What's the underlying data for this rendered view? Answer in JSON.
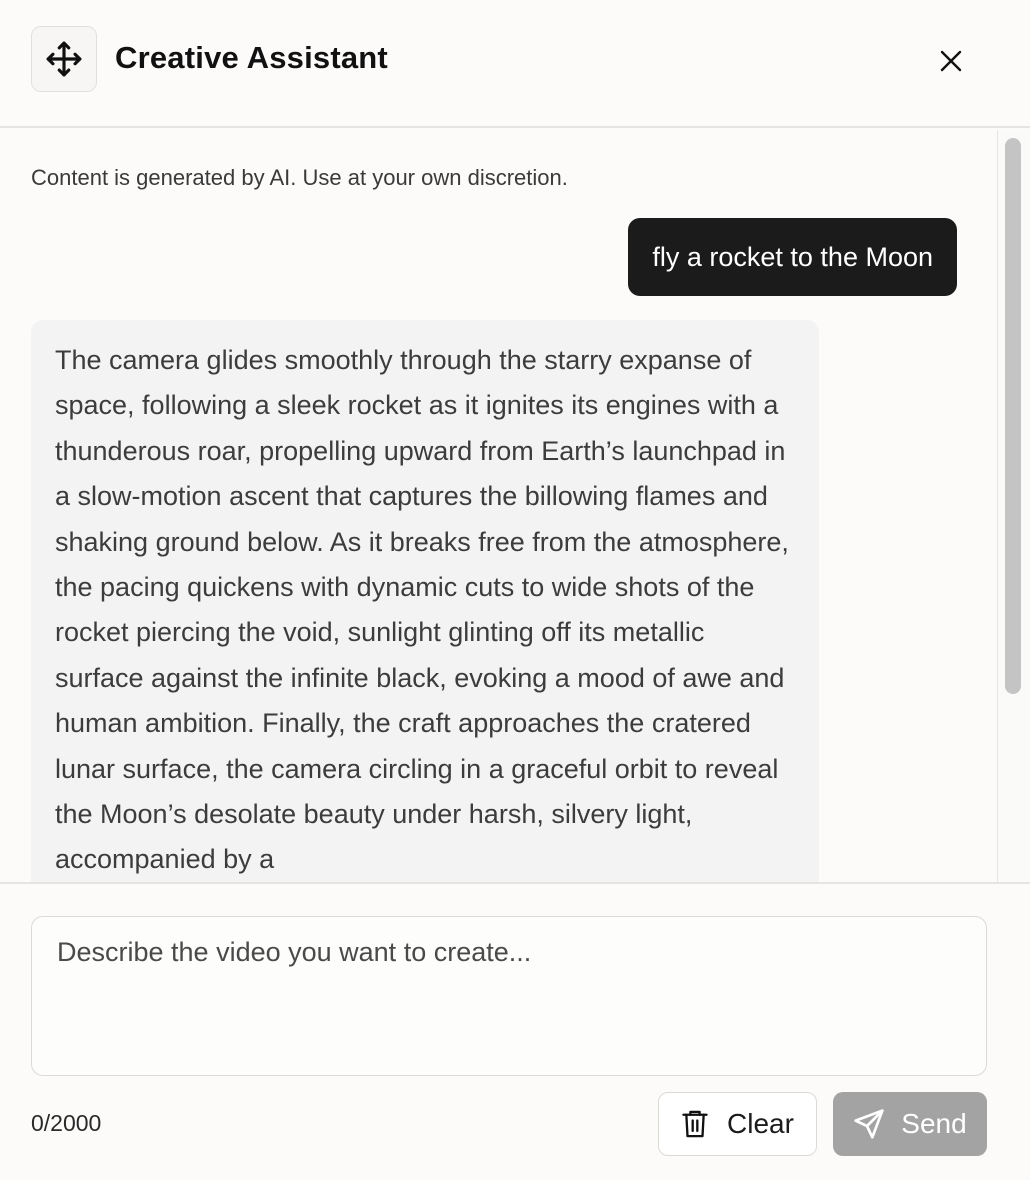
{
  "header": {
    "title": "Creative Assistant",
    "drag_icon": "move-icon",
    "close_icon": "close-icon"
  },
  "chat": {
    "disclaimer": "Content is generated by AI. Use at your own discretion.",
    "messages": [
      {
        "role": "user",
        "text": "fly a rocket to the Moon"
      },
      {
        "role": "assistant",
        "text": "The camera glides smoothly through the starry expanse of space, following a sleek rocket as it ignites its engines with a thunderous roar, propelling upward from Earth’s launchpad in a slow-motion ascent that captures the billowing flames and shaking ground below. As it breaks free from the atmosphere, the pacing quickens with dynamic cuts to wide shots of the rocket piercing the void, sunlight glinting off its metallic surface against the infinite black, evoking a mood of awe and human ambition. Finally, the craft approaches the cratered lunar surface, the camera circling in a graceful orbit to reveal the Moon’s desolate beauty under harsh, silvery light, accompanied by a"
      }
    ]
  },
  "composer": {
    "placeholder": "Describe the video you want to create...",
    "value": "",
    "char_count": "0/2000",
    "clear_label": "Clear",
    "clear_icon": "trash-icon",
    "send_label": "Send",
    "send_icon": "send-icon"
  },
  "colors": {
    "background": "#fcfbfa",
    "user_bubble": "#1b1b1b",
    "assistant_bubble": "#f3f3f4",
    "send_button_disabled": "#a3a3a3"
  }
}
